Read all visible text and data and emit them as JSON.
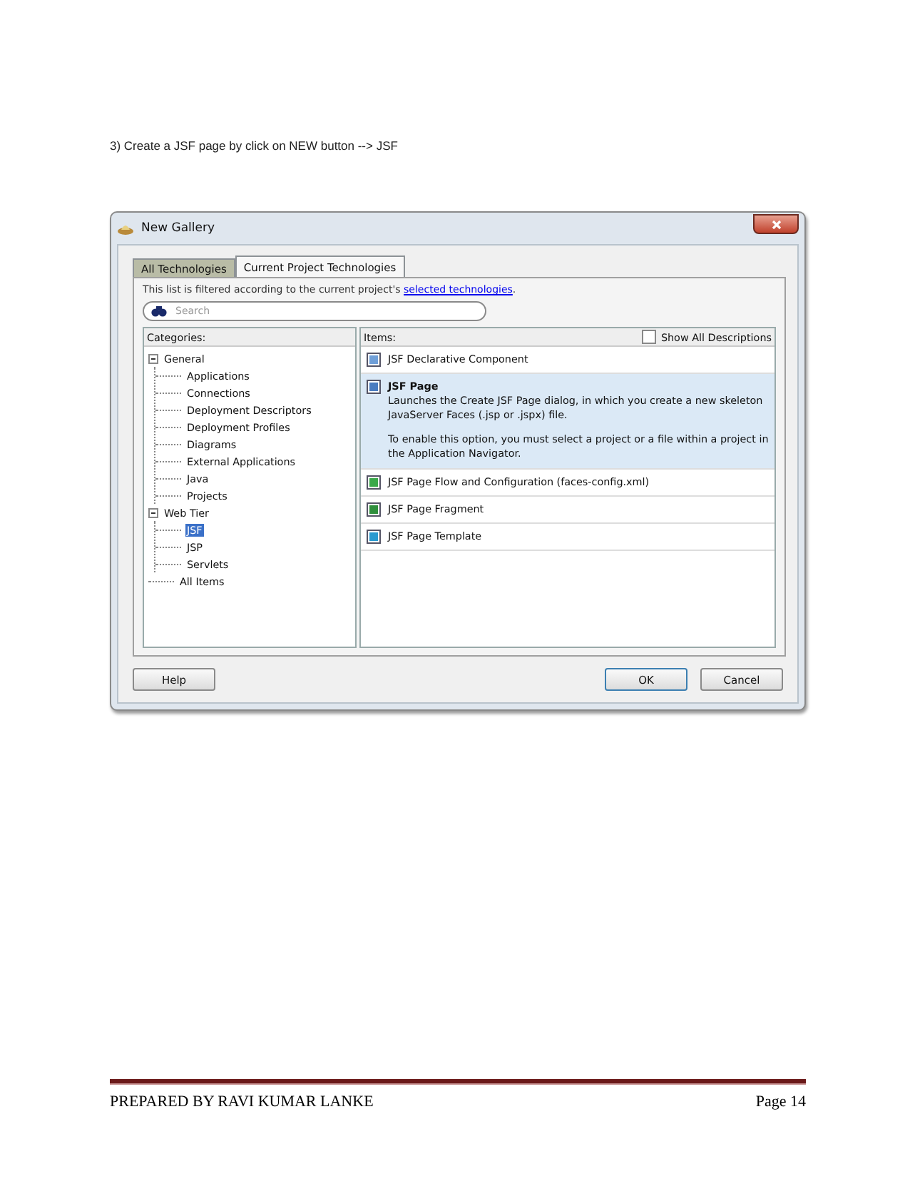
{
  "instruction": "3) Create a JSF page by click on NEW button --> JSF",
  "dialog": {
    "title": "New Gallery",
    "tabs": [
      {
        "label": "All Technologies",
        "selected": false
      },
      {
        "label": "Current Project Technologies",
        "selected": true
      }
    ],
    "filter_note": {
      "text": "This list is filtered according to the current project's ",
      "link": "selected technologies",
      "end": "."
    },
    "search": {
      "placeholder": "Search"
    },
    "categories": {
      "heading": "Categories:",
      "tree": [
        {
          "label": "General",
          "expanded": true,
          "selected": false,
          "children": [
            {
              "label": "Applications",
              "selected": false
            },
            {
              "label": "Connections",
              "selected": false
            },
            {
              "label": "Deployment Descriptors",
              "selected": false
            },
            {
              "label": "Deployment Profiles",
              "selected": false
            },
            {
              "label": "Diagrams",
              "selected": false
            },
            {
              "label": "External Applications",
              "selected": false
            },
            {
              "label": "Java",
              "selected": false
            },
            {
              "label": "Projects",
              "selected": false
            }
          ]
        },
        {
          "label": "Web Tier",
          "expanded": true,
          "selected": false,
          "children": [
            {
              "label": "JSF",
              "selected": true
            },
            {
              "label": "JSP",
              "selected": false
            },
            {
              "label": "Servlets",
              "selected": false
            }
          ]
        },
        {
          "label": "All Items",
          "selected": false
        }
      ]
    },
    "items": {
      "heading": "Items:",
      "show_all_descriptions": {
        "label": "Show All Descriptions",
        "checked": false
      },
      "list": [
        {
          "title": "JSF Declarative Component",
          "selected": false
        },
        {
          "title": "JSF Page",
          "selected": true,
          "description": [
            "Launches the Create JSF Page dialog, in which you create a new skeleton JavaServer Faces (.jsp or .jspx) file.",
            "To enable this option, you must select a project or a file within a project in the Application Navigator."
          ]
        },
        {
          "title": "JSF Page Flow and Configuration (faces-config.xml)",
          "selected": false
        },
        {
          "title": "JSF Page Fragment",
          "selected": false
        },
        {
          "title": "JSF Page Template",
          "selected": false
        }
      ]
    },
    "buttons": {
      "help": "Help",
      "ok": "OK",
      "cancel": "Cancel"
    }
  },
  "footer": {
    "author": "PREPARED BY RAVI KUMAR LANKE",
    "page": "Page 14"
  }
}
